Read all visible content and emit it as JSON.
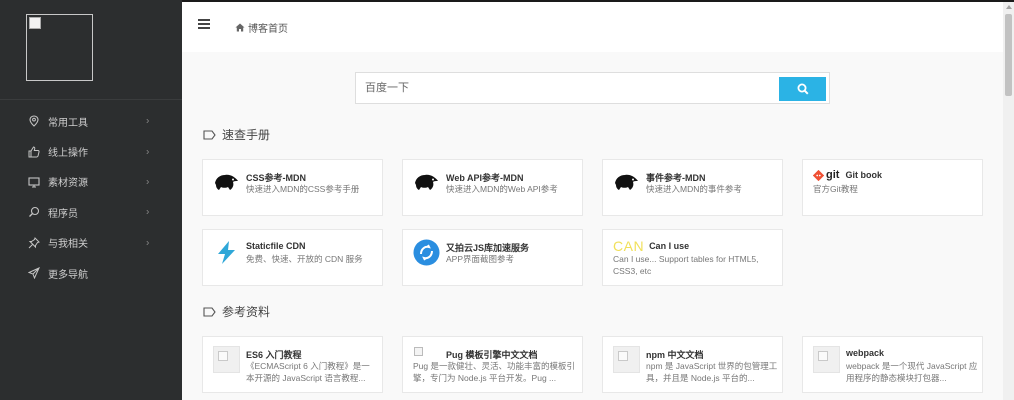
{
  "topbar": {
    "home_label": "博客首页"
  },
  "sidebar": {
    "items": [
      {
        "label": "常用工具",
        "icon": "location-pin-icon",
        "has_chevron": true
      },
      {
        "label": "线上操作",
        "icon": "thumbs-up-icon",
        "has_chevron": true
      },
      {
        "label": "素材资源",
        "icon": "monitor-icon",
        "has_chevron": true
      },
      {
        "label": "程序员",
        "icon": "search-icon",
        "has_chevron": true
      },
      {
        "label": "与我相关",
        "icon": "pin-icon",
        "has_chevron": true
      },
      {
        "label": "更多导航",
        "icon": "send-icon",
        "has_chevron": false
      }
    ]
  },
  "search": {
    "placeholder": "百度一下",
    "button_icon": "search-icon"
  },
  "sections": {
    "quick": {
      "title": "速查手册",
      "cards": [
        {
          "title": "CSS参考-MDN",
          "desc": "快速进入MDN的CSS参考手册",
          "icon": "mdn-dino-icon"
        },
        {
          "title": "Web API参考-MDN",
          "desc": "快速进入MDN的Web API参考",
          "icon": "mdn-dino-icon"
        },
        {
          "title": "事件参考-MDN",
          "desc": "快速进入MDN的事件参考",
          "icon": "mdn-dino-icon"
        },
        {
          "title": "Git book",
          "desc": "官方Git教程",
          "icon": "git-logo-icon",
          "logo_text": "git"
        },
        {
          "title": "Staticfile CDN",
          "desc": "免费、快速、开放的 CDN 服务",
          "icon": "lightning-icon"
        },
        {
          "title": "又拍云JS库加速服务",
          "desc": "APP界面截图参考",
          "icon": "upyun-icon"
        },
        {
          "title": "Can I use",
          "desc": "Can I use... Support tables for HTML5, CSS3, etc",
          "icon": "caniuse-logo-icon",
          "logo_text": "CAN"
        }
      ]
    },
    "reference": {
      "title": "参考资料",
      "cards": [
        {
          "title": "ES6 入门教程",
          "desc": "《ECMAScript 6 入门教程》是一本开源的 JavaScript 语言教程...",
          "icon": "placeholder-image-icon"
        },
        {
          "title": "Pug 模板引擎中文文档",
          "desc": "Pug 是一款健壮、灵活、功能丰富的模板引擎，专门为 Node.js 平台开发。Pug ...",
          "icon": "broken-image-icon"
        },
        {
          "title": "npm 中文文档",
          "desc": "npm 是 JavaScript 世界的包管理工具，并且是 Node.js 平台的...",
          "icon": "placeholder-image-icon"
        },
        {
          "title": "webpack",
          "desc": "webpack 是一个现代 JavaScript 应用程序的静态模块打包器...",
          "icon": "placeholder-image-icon"
        }
      ]
    }
  },
  "colors": {
    "sidebar_bg": "#2c2e2f",
    "accent": "#2bb3e5",
    "staticfile": "#2fa7d8",
    "git_orange": "#f05033",
    "caniuse_yellow": "#f1e05a"
  }
}
